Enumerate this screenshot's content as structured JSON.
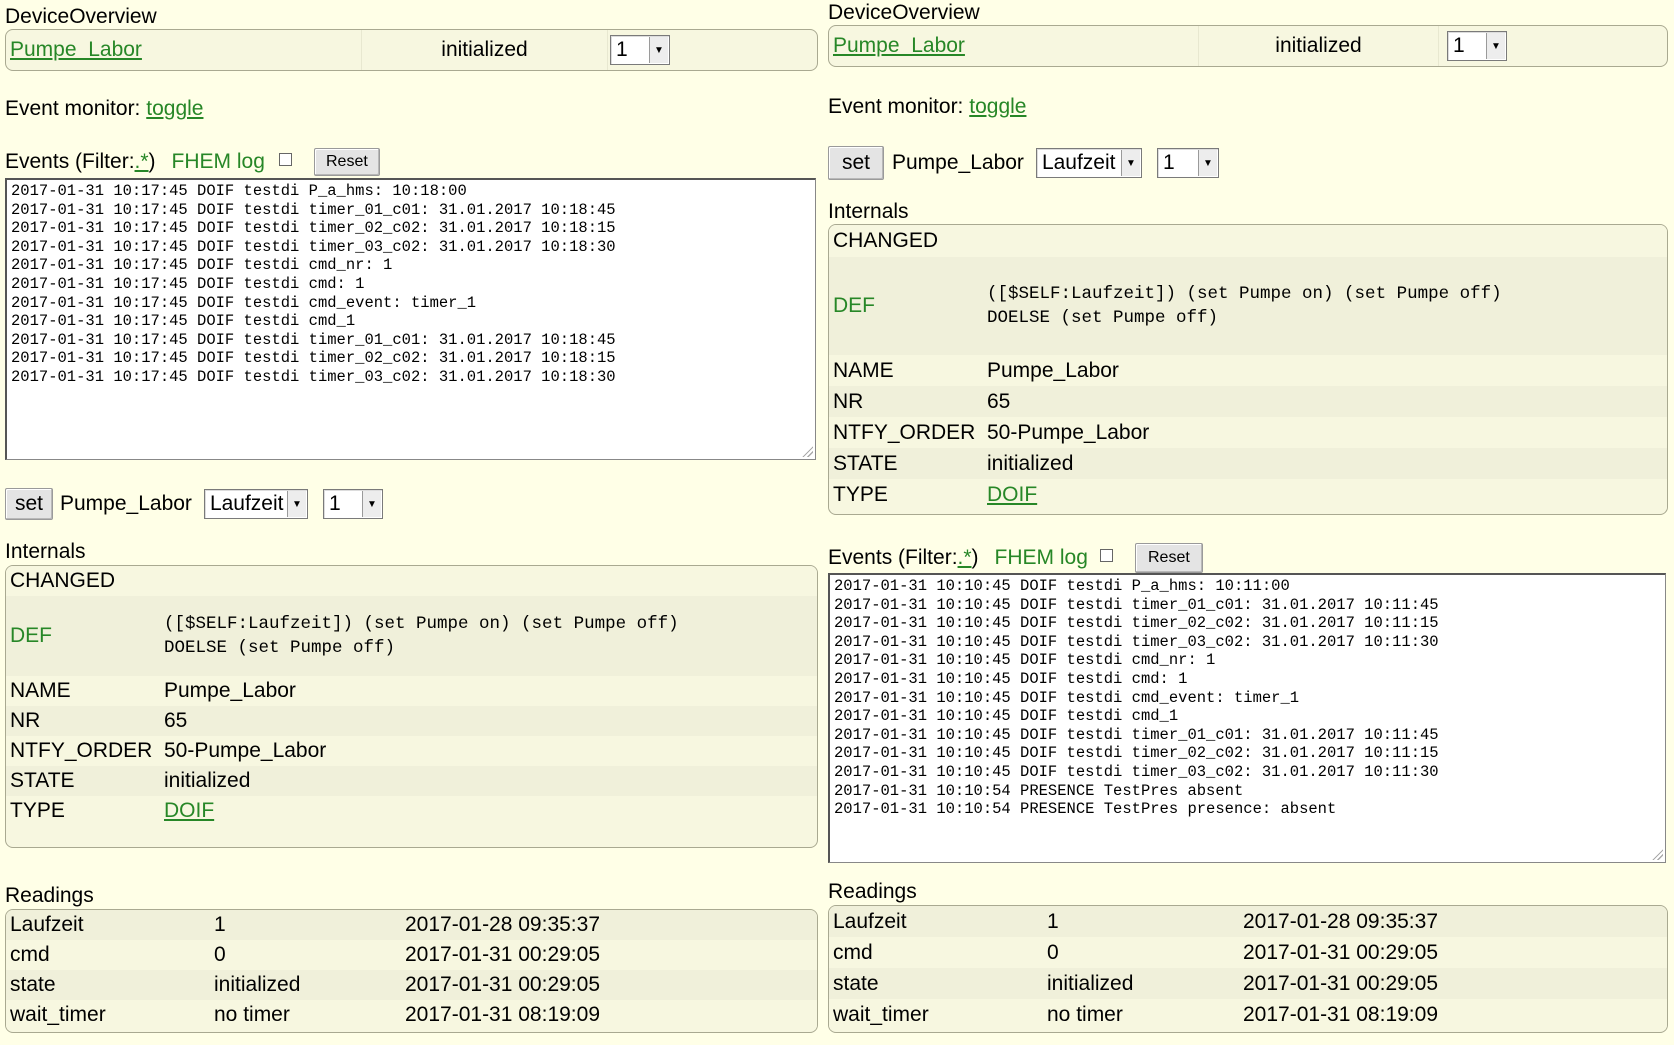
{
  "device_overview": {
    "title": "DeviceOverview",
    "device_name": "Pumpe_Labor",
    "state": "initialized",
    "select_value": "1"
  },
  "event_monitor": {
    "label": "Event monitor:",
    "toggle": "toggle"
  },
  "events_header": {
    "prefix": "Events (Filter: ",
    "filter": ".*",
    "suffix": ")",
    "fhem_log": "FHEM log",
    "reset": "Reset"
  },
  "events_left": [
    "2017-01-31 10:17:45 DOIF testdi P_a_hms: 10:18:00",
    "2017-01-31 10:17:45 DOIF testdi timer_01_c01: 31.01.2017 10:18:45",
    "2017-01-31 10:17:45 DOIF testdi timer_02_c02: 31.01.2017 10:18:15",
    "2017-01-31 10:17:45 DOIF testdi timer_03_c02: 31.01.2017 10:18:30",
    "2017-01-31 10:17:45 DOIF testdi cmd_nr: 1",
    "2017-01-31 10:17:45 DOIF testdi cmd: 1",
    "2017-01-31 10:17:45 DOIF testdi cmd_event: timer_1",
    "2017-01-31 10:17:45 DOIF testdi cmd_1",
    "2017-01-31 10:17:45 DOIF testdi timer_01_c01: 31.01.2017 10:18:45",
    "2017-01-31 10:17:45 DOIF testdi timer_02_c02: 31.01.2017 10:18:15",
    "2017-01-31 10:17:45 DOIF testdi timer_03_c02: 31.01.2017 10:18:30"
  ],
  "events_right": [
    "2017-01-31 10:10:45 DOIF testdi P_a_hms: 10:11:00",
    "2017-01-31 10:10:45 DOIF testdi timer_01_c01: 31.01.2017 10:11:45",
    "2017-01-31 10:10:45 DOIF testdi timer_02_c02: 31.01.2017 10:11:15",
    "2017-01-31 10:10:45 DOIF testdi timer_03_c02: 31.01.2017 10:11:30",
    "2017-01-31 10:10:45 DOIF testdi cmd_nr: 1",
    "2017-01-31 10:10:45 DOIF testdi cmd: 1",
    "2017-01-31 10:10:45 DOIF testdi cmd_event: timer_1",
    "2017-01-31 10:10:45 DOIF testdi cmd_1",
    "2017-01-31 10:10:45 DOIF testdi timer_01_c01: 31.01.2017 10:11:45",
    "2017-01-31 10:10:45 DOIF testdi timer_02_c02: 31.01.2017 10:11:15",
    "2017-01-31 10:10:45 DOIF testdi timer_03_c02: 31.01.2017 10:11:30",
    "2017-01-31 10:10:54 PRESENCE TestPres absent",
    "2017-01-31 10:10:54 PRESENCE TestPres presence: absent"
  ],
  "set_row": {
    "button": "set",
    "device": "Pumpe_Labor",
    "attr_select": "Laufzeit",
    "value_select": "1"
  },
  "internals": {
    "title": "Internals",
    "changed": "CHANGED",
    "def_key": "DEF",
    "def_line1": "([$SELF:Laufzeit]) (set Pumpe on) (set Pumpe off)",
    "def_line2": "DOELSE (set Pumpe off)",
    "rows": [
      {
        "key": "NAME",
        "value": "Pumpe_Labor"
      },
      {
        "key": "NR",
        "value": "65"
      },
      {
        "key": "NTFY_ORDER",
        "value": "50-Pumpe_Labor"
      },
      {
        "key": "STATE",
        "value": "initialized"
      }
    ],
    "type_key": "TYPE",
    "type_value": "DOIF"
  },
  "readings": {
    "title": "Readings",
    "rows": [
      {
        "name": "Laufzeit",
        "value": "1",
        "time": "2017-01-28 09:35:37"
      },
      {
        "name": "cmd",
        "value": "0",
        "time": "2017-01-31 00:29:05"
      },
      {
        "name": "state",
        "value": "initialized",
        "time": "2017-01-31 00:29:05"
      },
      {
        "name": "wait_timer",
        "value": "no timer",
        "time": "2017-01-31 08:19:09"
      }
    ]
  }
}
